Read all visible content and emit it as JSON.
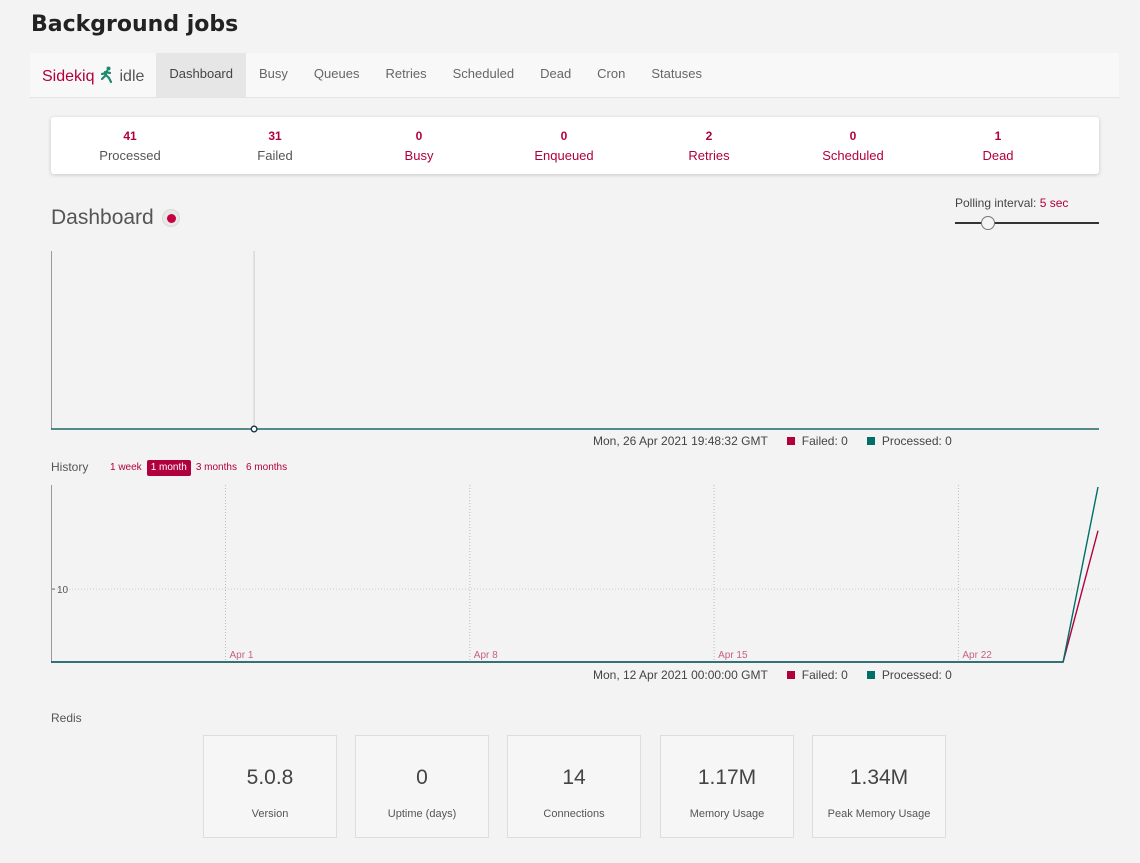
{
  "page": {
    "title": "Background jobs"
  },
  "brand": {
    "name": "Sidekiq",
    "status": "idle",
    "icon": "runner-icon",
    "color": "#b1003e",
    "icon_color": "#1f8a70"
  },
  "nav": {
    "tabs": [
      {
        "label": "Dashboard",
        "active": true
      },
      {
        "label": "Busy"
      },
      {
        "label": "Queues"
      },
      {
        "label": "Retries"
      },
      {
        "label": "Scheduled"
      },
      {
        "label": "Dead"
      },
      {
        "label": "Cron"
      },
      {
        "label": "Statuses"
      }
    ]
  },
  "summary": {
    "processed": {
      "count": "41",
      "label": "Processed"
    },
    "failed": {
      "count": "31",
      "label": "Failed"
    },
    "busy": {
      "count": "0",
      "label": "Busy"
    },
    "enqueued": {
      "count": "0",
      "label": "Enqueued"
    },
    "retries": {
      "count": "2",
      "label": "Retries"
    },
    "scheduled": {
      "count": "0",
      "label": "Scheduled"
    },
    "dead": {
      "count": "1",
      "label": "Dead"
    }
  },
  "dashboard": {
    "title": "Dashboard",
    "polling_label": "Polling interval:",
    "polling_value": "5 sec",
    "polling_level": 0.2
  },
  "colors": {
    "failed": "#b1003e",
    "processed": "#006f68",
    "accent": "#b1003e"
  },
  "realtime_legend": {
    "time": "Mon, 26 Apr 2021 19:48:32 GMT",
    "failed": "Failed: 0",
    "processed": "Processed: 0"
  },
  "history": {
    "label": "History",
    "ranges": [
      {
        "label": "1 week"
      },
      {
        "label": "1 month",
        "active": true
      },
      {
        "label": "3 months"
      },
      {
        "label": "6 months"
      }
    ],
    "legend": {
      "time": "Mon, 12 Apr 2021 00:00:00 GMT",
      "failed": "Failed: 0",
      "processed": "Processed: 0"
    }
  },
  "chart_data": [
    {
      "type": "line",
      "series": [
        {
          "name": "Failed",
          "x": [
            0,
            1
          ],
          "values": [
            0,
            0
          ]
        },
        {
          "name": "Processed",
          "x": [
            0,
            1
          ],
          "values": [
            0,
            0
          ]
        }
      ],
      "hover_x": 0,
      "x_range": [
        0,
        5.16
      ],
      "ylim": [
        0,
        1
      ],
      "grid": false
    },
    {
      "type": "line",
      "x": [
        "Mar 27",
        "Mar 28",
        "Mar 29",
        "Mar 30",
        "Mar 31",
        "Apr 1",
        "Apr 2",
        "Apr 3",
        "Apr 4",
        "Apr 5",
        "Apr 6",
        "Apr 7",
        "Apr 8",
        "Apr 9",
        "Apr 10",
        "Apr 11",
        "Apr 12",
        "Apr 13",
        "Apr 14",
        "Apr 15",
        "Apr 16",
        "Apr 17",
        "Apr 18",
        "Apr 19",
        "Apr 20",
        "Apr 21",
        "Apr 22",
        "Apr 23",
        "Apr 24",
        "Apr 25",
        "Apr 26"
      ],
      "series": [
        {
          "name": "Failed",
          "values": [
            0,
            0,
            0,
            0,
            0,
            0,
            0,
            0,
            0,
            0,
            0,
            0,
            0,
            0,
            0,
            0,
            0,
            0,
            0,
            0,
            0,
            0,
            0,
            0,
            0,
            0,
            0,
            0,
            0,
            0,
            18
          ]
        },
        {
          "name": "Processed",
          "values": [
            0,
            0,
            0,
            0,
            0,
            0,
            0,
            0,
            0,
            0,
            0,
            0,
            0,
            0,
            0,
            0,
            0,
            0,
            0,
            0,
            0,
            0,
            0,
            0,
            0,
            0,
            0,
            0,
            0,
            0,
            24
          ]
        }
      ],
      "x_ticks": [
        "Apr 1",
        "Apr 8",
        "Apr 15",
        "Apr 22"
      ],
      "y_ticks": [
        "10"
      ],
      "ylim": [
        0,
        24
      ],
      "grid": true
    }
  ],
  "redis": {
    "label": "Redis",
    "stats": [
      {
        "value": "5.0.8",
        "caption": "Version"
      },
      {
        "value": "0",
        "caption": "Uptime (days)"
      },
      {
        "value": "14",
        "caption": "Connections"
      },
      {
        "value": "1.17M",
        "caption": "Memory Usage"
      },
      {
        "value": "1.34M",
        "caption": "Peak Memory Usage"
      }
    ]
  }
}
